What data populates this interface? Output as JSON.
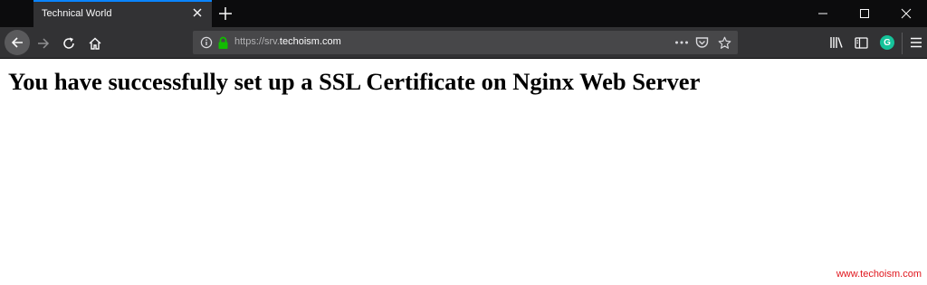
{
  "browser": {
    "tab": {
      "title": "Technical World"
    },
    "url": {
      "prefix": "https://srv.",
      "host": "techoism.com"
    },
    "extension": {
      "letter": "G"
    }
  },
  "page": {
    "heading": "You have successfully set up a SSL Certificate on Nginx Web Server"
  },
  "watermark": "www.techoism.com",
  "colors": {
    "tab_accent": "#0a84ff",
    "secure_lock": "#12bc00",
    "watermark": "#e0161d"
  }
}
